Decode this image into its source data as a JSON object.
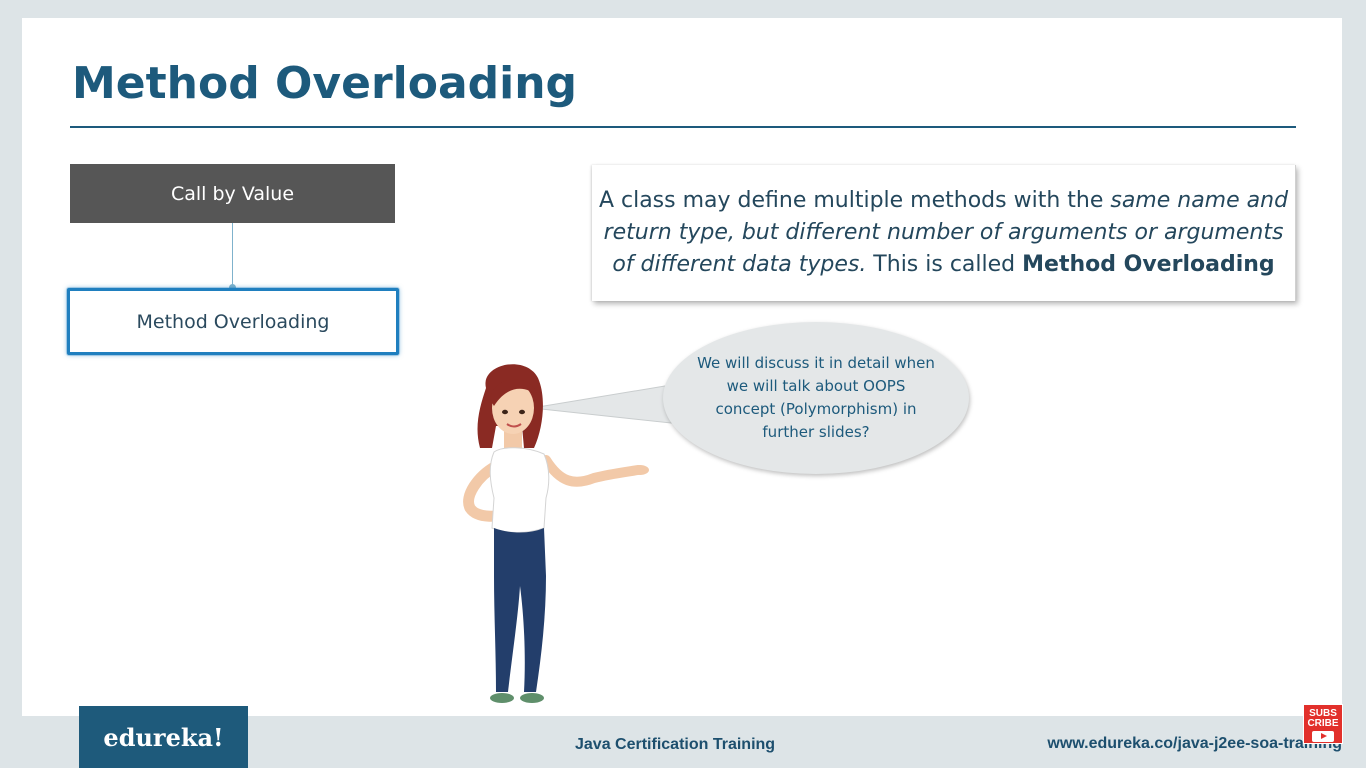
{
  "slide": {
    "title": "Method Overloading"
  },
  "diagram": {
    "parent_box": "Call by Value",
    "child_box": "Method Overloading"
  },
  "definition": {
    "part1": "A class may define multiple methods with the ",
    "italic": "same name and return type, but different  number of arguments or arguments of different data types.",
    "part2": " This is called ",
    "bold": "Method Overloading"
  },
  "speech_bubble": {
    "text": "We will discuss it in detail when we will talk about OOPS concept (Polymorphism) in further slides?"
  },
  "footer": {
    "logo": "edureka!",
    "course": "Java Certification Training",
    "website": "www.edureka.co/java-j2ee-soa-training"
  },
  "subscribe_badge": {
    "line1": "SUBS",
    "line2": "CRIBE"
  },
  "colors": {
    "title": "#1d5a7c",
    "gray_box": "#565656",
    "highlight_border": "#1f7fbf",
    "footer_bg": "#dde4e7",
    "logo_bg": "#1e5a7b",
    "subscribe_red": "#e2302b"
  },
  "icons": {
    "presenter": "presenter-woman-illustration",
    "subscribe": "youtube-subscribe-icon"
  }
}
